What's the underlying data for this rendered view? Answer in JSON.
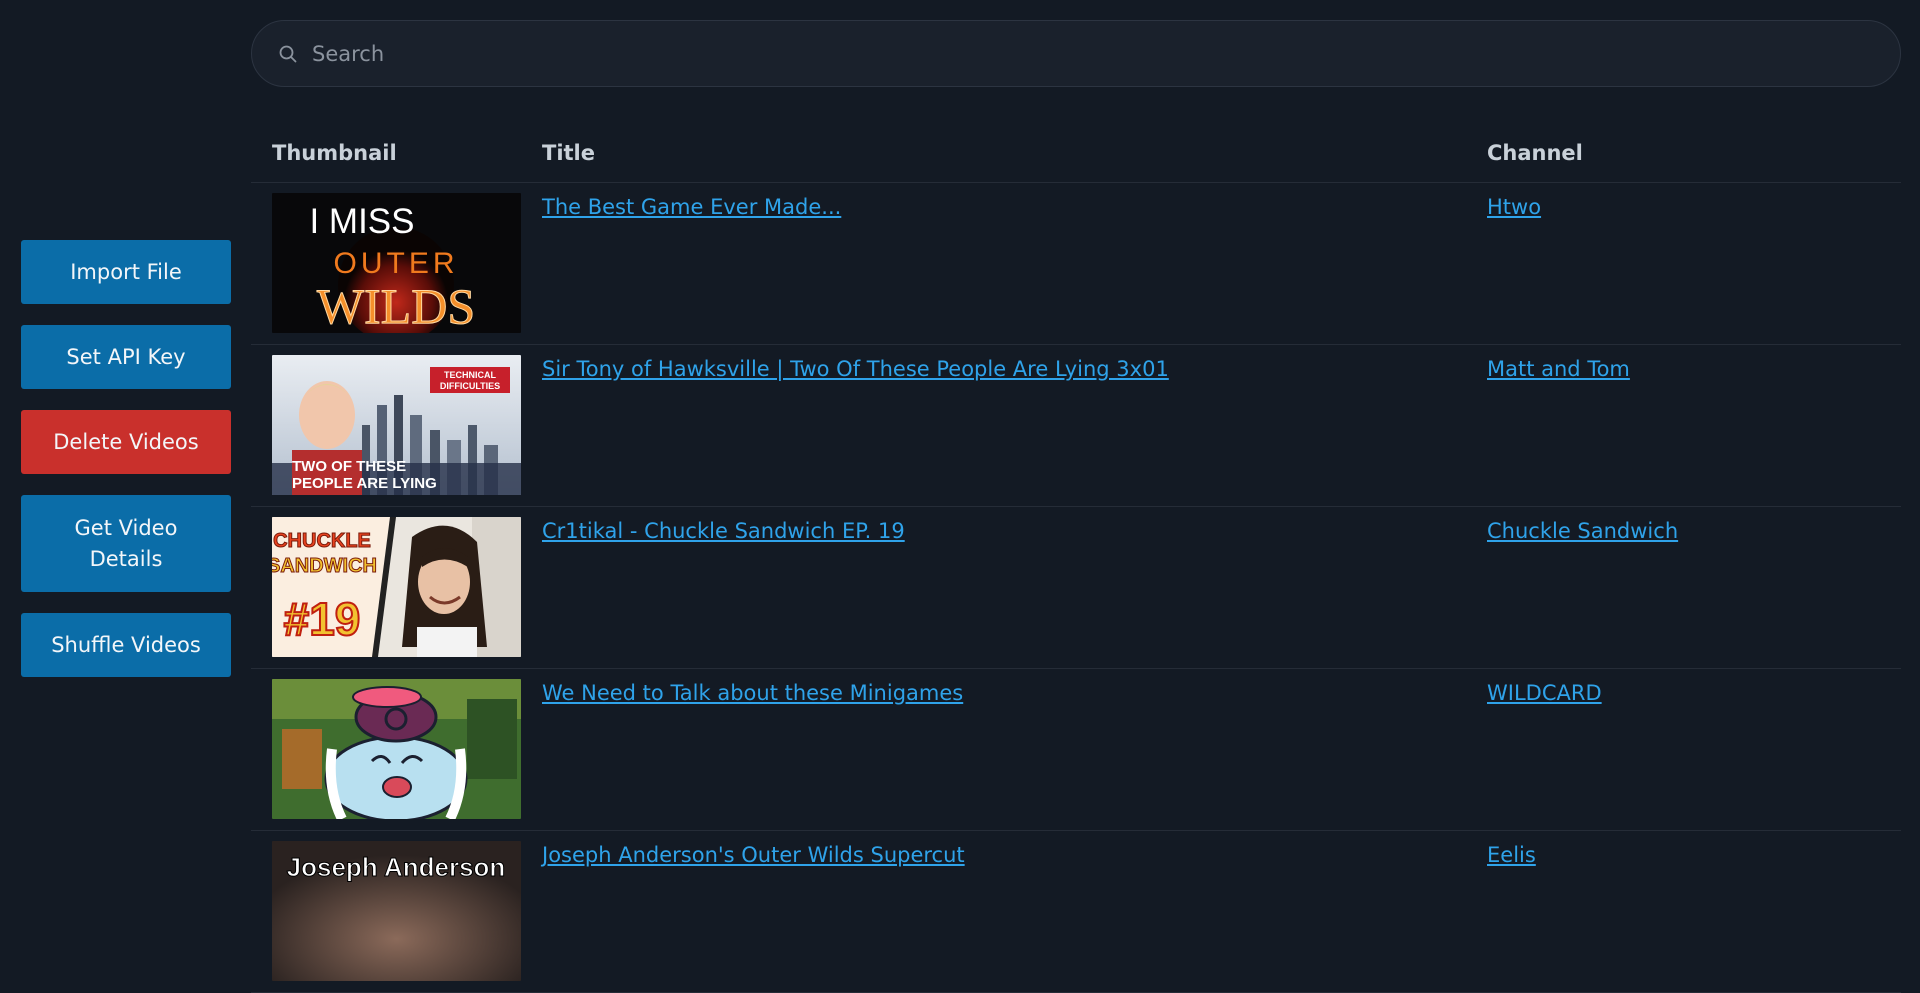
{
  "sidebar": {
    "import_label": "Import File",
    "api_key_label": "Set API Key",
    "delete_label": "Delete Videos",
    "details_label": "Get Video Details",
    "shuffle_label": "Shuffle Videos"
  },
  "search": {
    "placeholder": "Search",
    "value": ""
  },
  "table": {
    "headers": {
      "thumbnail": "Thumbnail",
      "title": "Title",
      "channel": "Channel"
    },
    "rows": [
      {
        "title": "The Best Game Ever Made...",
        "channel": "Htwo",
        "thumb_text": [
          "I MISS",
          "OUTER",
          "WILDS"
        ]
      },
      {
        "title": "Sir Tony of Hawksville | Two Of These People Are Lying 3x01",
        "channel": "Matt and Tom",
        "thumb_text": [
          "TECHNICAL",
          "DIFFICULTIES",
          "TWO OF THESE",
          "PEOPLE ARE LYING"
        ]
      },
      {
        "title": "Cr1tikal - Chuckle Sandwich EP. 19",
        "channel": "Chuckle Sandwich",
        "thumb_text": [
          "CHUCKLE",
          "SANDWICH",
          "#19"
        ]
      },
      {
        "title": "We Need to Talk about these Minigames",
        "channel": "WILDCARD",
        "thumb_text": []
      },
      {
        "title": "Joseph Anderson's Outer Wilds Supercut",
        "channel": "Eelis",
        "thumb_text": [
          "Joseph Anderson"
        ]
      }
    ]
  }
}
